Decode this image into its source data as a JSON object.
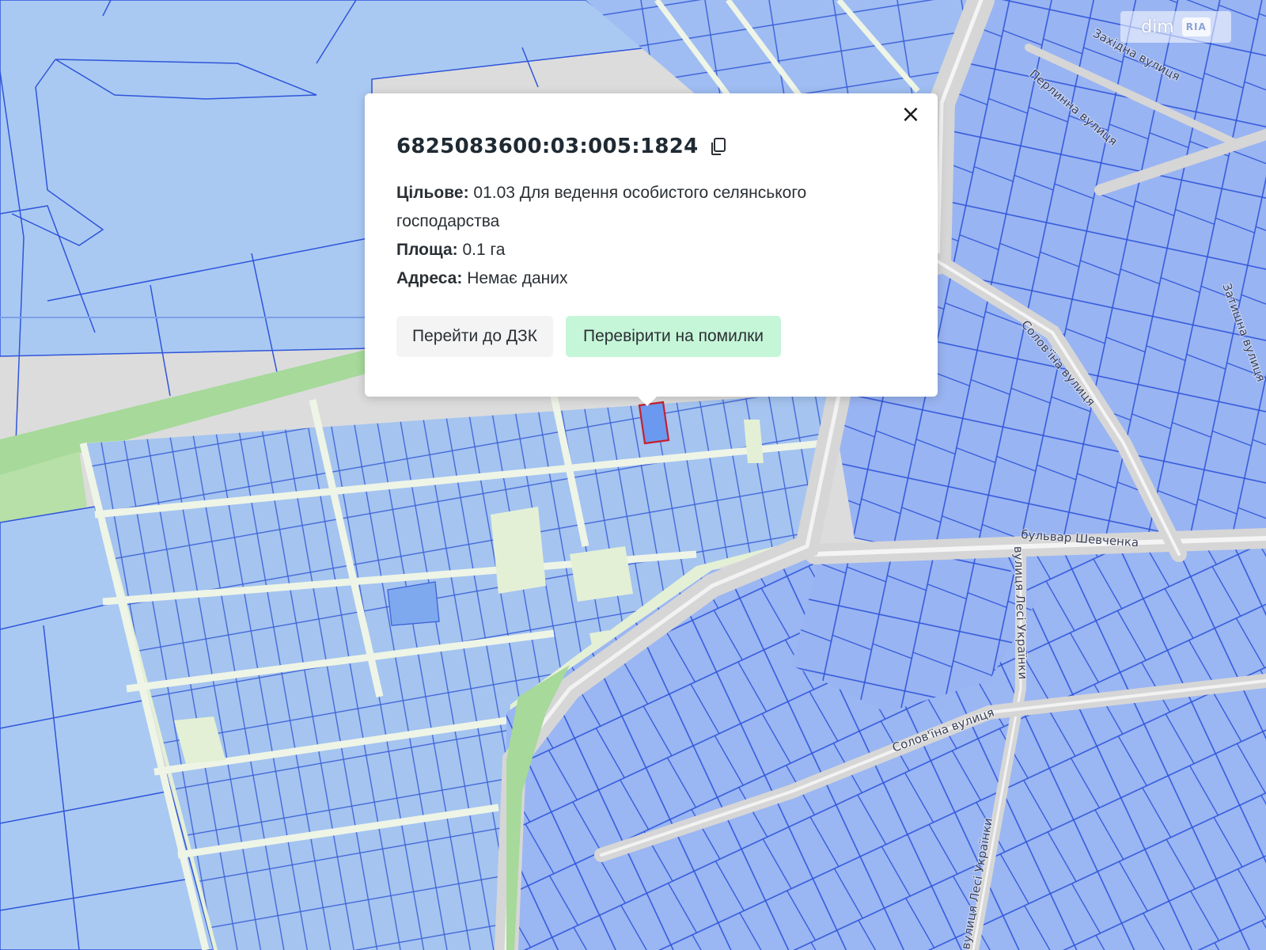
{
  "map": {
    "street_labels": [
      "Західна вулиця",
      "Перлинна вулиця",
      "Затишна вулиця",
      "Солов'їна вулиця",
      "бульвар Шевченка",
      "вулиця Лесі Українки",
      "Солов'їна вулиця",
      "вулиця Лесі Українки"
    ],
    "colors": {
      "parcel_fill": "#9db9f4",
      "parcel_stroke": "#2f55d9",
      "large_parcel_fill": "#a9c9f3",
      "road": "#dcdcdc",
      "road_highlight": "#f3f3f3",
      "field_light": "#dff0d2",
      "green_strip": "#a6d99a",
      "selected_parcel_fill": "#6b99ef",
      "selected_parcel_stroke": "#c42030"
    }
  },
  "watermark": {
    "text": "dim",
    "mark_text": "RIA"
  },
  "popup": {
    "parcel_id": "6825083600:03:005:1824",
    "copy_icon": "copy-icon",
    "close_icon": "close-icon",
    "close_symbol": "×",
    "purpose_label": "Цільове:",
    "purpose_value": "01.03 Для ведення особистого селянського господарства",
    "area_label": "Площа:",
    "area_value": "0.1 га",
    "address_label": "Адреса:",
    "address_value": "Немає даних",
    "btn_dzk": "Перейти до ДЗК",
    "btn_check": "Перевірити на помилки"
  }
}
